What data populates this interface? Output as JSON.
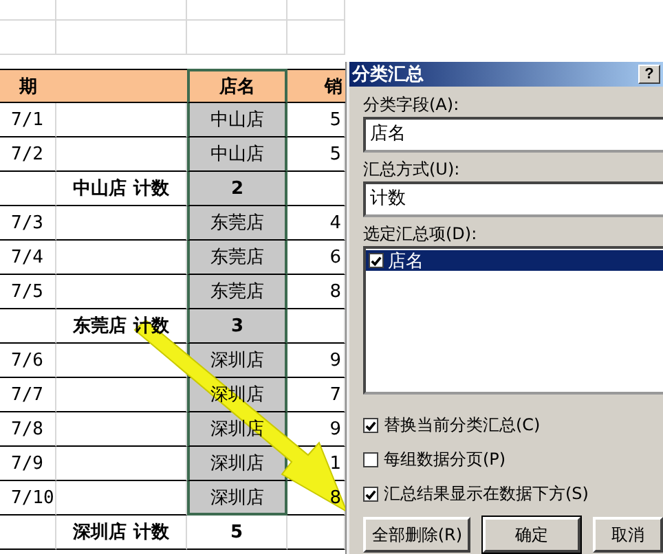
{
  "sheet": {
    "columns": [
      {
        "heading": "期",
        "selected": false
      },
      {
        "selected": false
      },
      {
        "heading": "店名",
        "selected": true
      },
      {
        "heading": "销",
        "selected": false
      }
    ],
    "rows": [
      {
        "kind": "data",
        "selected": true,
        "cells": [
          "7/1",
          "",
          "中山店",
          "5"
        ]
      },
      {
        "kind": "data",
        "selected": true,
        "cells": [
          "7/2",
          "",
          "中山店",
          "5"
        ]
      },
      {
        "kind": "subtotal",
        "selected": true,
        "cells": [
          "",
          "中山店  计数",
          "2",
          ""
        ]
      },
      {
        "kind": "data",
        "selected": true,
        "cells": [
          "7/3",
          "",
          "东莞店",
          "4"
        ]
      },
      {
        "kind": "data",
        "selected": true,
        "cells": [
          "7/4",
          "",
          "东莞店",
          "6"
        ]
      },
      {
        "kind": "data",
        "selected": true,
        "cells": [
          "7/5",
          "",
          "东莞店",
          "8"
        ]
      },
      {
        "kind": "subtotal",
        "selected": true,
        "cells": [
          "",
          "东莞店  计数",
          "3",
          ""
        ]
      },
      {
        "kind": "data",
        "selected": true,
        "cells": [
          "7/6",
          "",
          "深圳店",
          "9"
        ]
      },
      {
        "kind": "data",
        "selected": true,
        "cells": [
          "7/7",
          "",
          "深圳店",
          "7"
        ]
      },
      {
        "kind": "data",
        "selected": true,
        "cells": [
          "7/8",
          "",
          "深圳店",
          "9"
        ]
      },
      {
        "kind": "data",
        "selected": true,
        "cells": [
          "7/9",
          "",
          "深圳店",
          "1"
        ]
      },
      {
        "kind": "data",
        "selected": true,
        "cells": [
          "7/10",
          "",
          "深圳店",
          "8"
        ]
      },
      {
        "kind": "subtotal",
        "selected": false,
        "cells": [
          "",
          "深圳店  计数",
          "5",
          ""
        ]
      }
    ]
  },
  "dialog": {
    "title": "分类汇总",
    "help": "?",
    "fields": [
      {
        "label": "分类字段(A):",
        "value": "店名"
      },
      {
        "label": "汇总方式(U):",
        "value": "计数"
      }
    ],
    "list_label": "选定汇总项(D):",
    "list_items": [
      {
        "label": "店名",
        "checked": true,
        "selected": true
      }
    ],
    "options": [
      {
        "label": "替换当前分类汇总(C)",
        "checked": true
      },
      {
        "label": "每组数据分页(P)",
        "checked": false
      },
      {
        "label": "汇总结果显示在数据下方(S)",
        "checked": true
      }
    ],
    "buttons": [
      "全部删除(R)",
      "确定",
      "取消"
    ]
  }
}
